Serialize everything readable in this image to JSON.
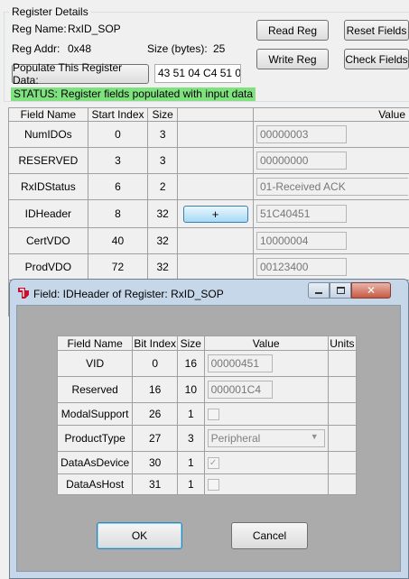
{
  "register": {
    "group_title": "Register Details",
    "name_label": "Reg Name:",
    "name_value": "RxID_SOP",
    "addr_label": "Reg Addr:",
    "addr_value": "0x48",
    "size_label": "Size (bytes):",
    "size_value": "25",
    "populate_button": "Populate This Register Data:",
    "populate_input": "43 51 04 C4 51 04 0",
    "status": "STATUS: Register fields populated with input data"
  },
  "buttons": {
    "read": "Read Reg",
    "reset": "Reset Fields",
    "write": "Write Reg",
    "check": "Check Fields"
  },
  "main_table": {
    "headers": [
      "Field Name",
      "Start Index",
      "Size",
      "",
      "Value"
    ],
    "rows": [
      {
        "name": "NumIDOs",
        "start": "0",
        "size": "3",
        "value": "00000003"
      },
      {
        "name": "RESERVED",
        "start": "3",
        "size": "3",
        "value": "00000000"
      },
      {
        "name": "RxIDStatus",
        "start": "6",
        "size": "2",
        "value": "01-Received ACK"
      },
      {
        "name": "IDHeader",
        "start": "8",
        "size": "32",
        "button": "+",
        "value": "51C40451"
      },
      {
        "name": "CertVDO",
        "start": "40",
        "size": "32",
        "value": "10000004"
      },
      {
        "name": "ProdVDO",
        "start": "72",
        "size": "32",
        "value": "00123400"
      }
    ]
  },
  "dialog": {
    "title": "Field: IDHeader of Register: RxID_SOP",
    "headers": [
      "Field Name",
      "Bit Index",
      "Size",
      "Value",
      "Units"
    ],
    "rows": [
      {
        "name": "VID",
        "bit": "0",
        "size": "16",
        "value": "00000451"
      },
      {
        "name": "Reserved",
        "bit": "16",
        "size": "10",
        "value": "000001C4"
      },
      {
        "name": "ModalSupport",
        "bit": "26",
        "size": "1",
        "checked": false
      },
      {
        "name": "ProductType",
        "bit": "27",
        "size": "3",
        "value": "Peripheral"
      },
      {
        "name": "DataAsDevice",
        "bit": "30",
        "size": "1",
        "checked": true
      },
      {
        "name": "DataAsHost",
        "bit": "31",
        "size": "1",
        "checked": false
      }
    ],
    "ok": "OK",
    "cancel": "Cancel"
  }
}
